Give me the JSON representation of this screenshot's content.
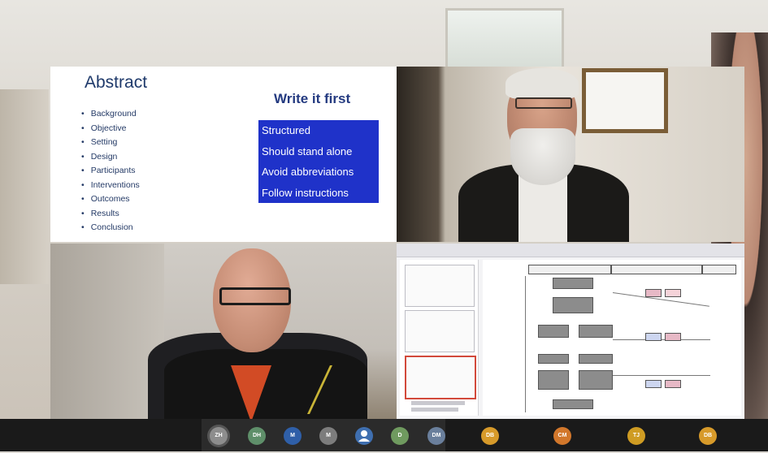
{
  "slide": {
    "title": "Abstract",
    "bullets": [
      "Background",
      "Objective",
      "Setting",
      "Design",
      "Participants",
      "Interventions",
      "Outcomes",
      "Results",
      "Conclusion"
    ],
    "write_first": "Write it first",
    "box_items": [
      "Structured",
      "Should stand alone",
      "Avoid abbreviations",
      "Follow instructions"
    ],
    "box_color": "#1f32c9"
  },
  "participants": [
    {
      "initials": "ZH",
      "color": "#8d8d8d"
    },
    {
      "initials": "DH",
      "color": "#5f8f6a"
    },
    {
      "initials": "M",
      "color": "#2f5fa8"
    },
    {
      "initials": "M",
      "color": "#7d7d7d"
    },
    {
      "initials": "",
      "color": "#3f6fb0",
      "icon": "participant-icon"
    },
    {
      "initials": "D",
      "color": "#6f9a5f"
    },
    {
      "initials": "DM",
      "color": "#6a7f9c"
    },
    {
      "initials": "DB",
      "color": "#d79a2a"
    },
    {
      "initials": "CM",
      "color": "#d2772b"
    },
    {
      "initials": "TJ",
      "color": "#cf9c23"
    },
    {
      "initials": "DB",
      "color": "#d79a2a"
    }
  ]
}
